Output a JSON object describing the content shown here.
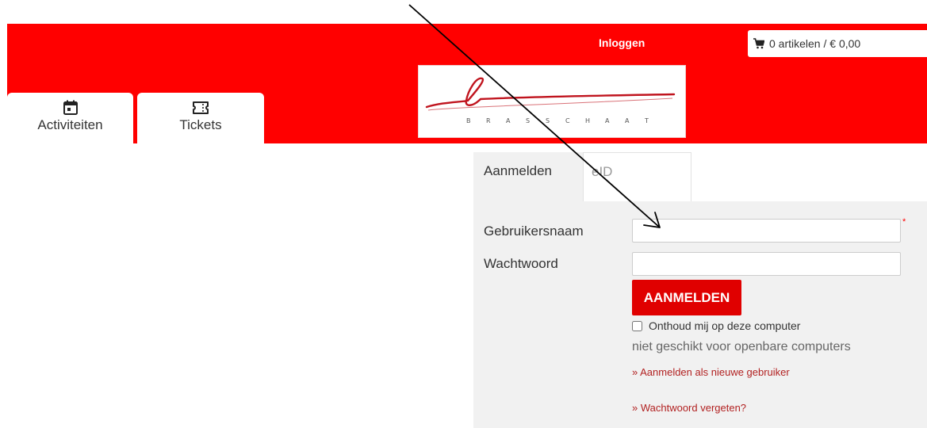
{
  "header": {
    "login_label": "Inloggen",
    "cart_label": "0 artikelen / € 0,00",
    "cart_icon": "shopping-cart-icon",
    "brand_color": "#ff0000",
    "logo": {
      "wordmark": "BRASSCHAAT",
      "letters": [
        "B",
        "R",
        "A",
        "S",
        "S",
        "C",
        "H",
        "A",
        "A",
        "T"
      ]
    }
  },
  "nav_tabs": [
    {
      "label": "Activiteiten",
      "icon": "calendar-icon"
    },
    {
      "label": "Tickets",
      "icon": "ticket-icon"
    }
  ],
  "login": {
    "tabs": [
      {
        "label": "Aanmelden",
        "active": true
      },
      {
        "label": "eID",
        "active": false
      }
    ],
    "username_label": "Gebruikersnaam",
    "username_value": "",
    "password_label": "Wachtwoord",
    "password_value": "",
    "required_marker": "*",
    "submit_label": "AANMELDEN",
    "remember_label": "Onthoud mij op deze computer",
    "remember_checked": false,
    "remember_hint": "niet geschikt voor openbare computers",
    "register_link": "» Aanmelden als nieuwe gebruiker",
    "forgot_link": "» Wachtwoord vergeten?",
    "accent_color": "#e00000",
    "link_color": "#b22222"
  }
}
